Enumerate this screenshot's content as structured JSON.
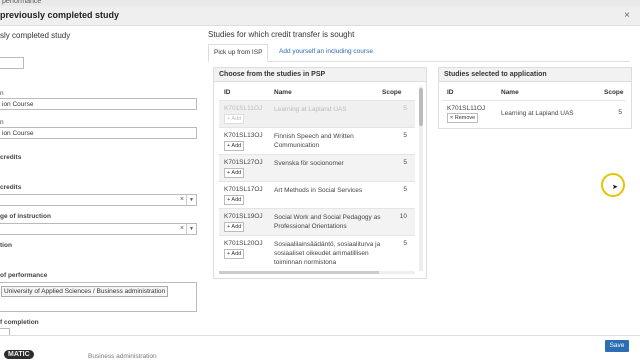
{
  "header": {
    "top_fragment": "performance",
    "title": "previously completed study"
  },
  "left": {
    "section_title": "sly completed study",
    "fields": [
      {
        "label": "",
        "value": ""
      },
      {
        "label": "n",
        "value": "ion Course"
      },
      {
        "label": "n",
        "value": "ion Course"
      },
      {
        "label": "credits",
        "value": ""
      },
      {
        "label": "credits",
        "value": ""
      },
      {
        "label": "ge of instruction",
        "value": ""
      },
      {
        "label": "tion",
        "value": ""
      },
      {
        "label": "of performance",
        "value": "University of Applied Sciences / Business administration"
      },
      {
        "label": "f completion",
        "value": ""
      }
    ],
    "bottom_fragment": "Business administration"
  },
  "right": {
    "title": "Studies for which credit transfer is sought",
    "tabs": [
      {
        "label": "Pick up from ISP"
      },
      {
        "label": "Add yourself an including course"
      }
    ],
    "choose_panel": {
      "title": "Choose from the studies in PSP",
      "col_id": "ID",
      "col_name": "Name",
      "col_scope": "Scope",
      "add_label": "+ Add",
      "rows": [
        {
          "id": "K701SL11OJ",
          "name": "Learning at Lapland UAS",
          "scope": "5"
        },
        {
          "id": "K701SL13OJ",
          "name": "Finnish Speech and Written Communication",
          "scope": "5"
        },
        {
          "id": "K701SL27OJ",
          "name": "Svenska för socionomer",
          "scope": "5"
        },
        {
          "id": "K701SL17OJ",
          "name": "Art Methods in Social Services",
          "scope": "5"
        },
        {
          "id": "K701SL19OJ",
          "name": "Social Work and Social Pedagogy as Professional Orientations",
          "scope": "10"
        },
        {
          "id": "K701SL20OJ",
          "name": "Sosiaalilainsäädäntö, sosiaaliturva ja sosiaaliset oikeudet ammatillisen toiminnan normistona",
          "scope": "5"
        }
      ]
    },
    "selected_panel": {
      "title": "Studies selected to application",
      "col_id": "ID",
      "col_name": "Name",
      "col_scope": "Scope",
      "remove_label": "× Remove",
      "row": {
        "id": "K701SL11OJ",
        "name": "Learning at Lapland UAS",
        "scope": "5"
      }
    }
  },
  "footer": {
    "save_label": "Save",
    "watermark": "MATIC"
  }
}
